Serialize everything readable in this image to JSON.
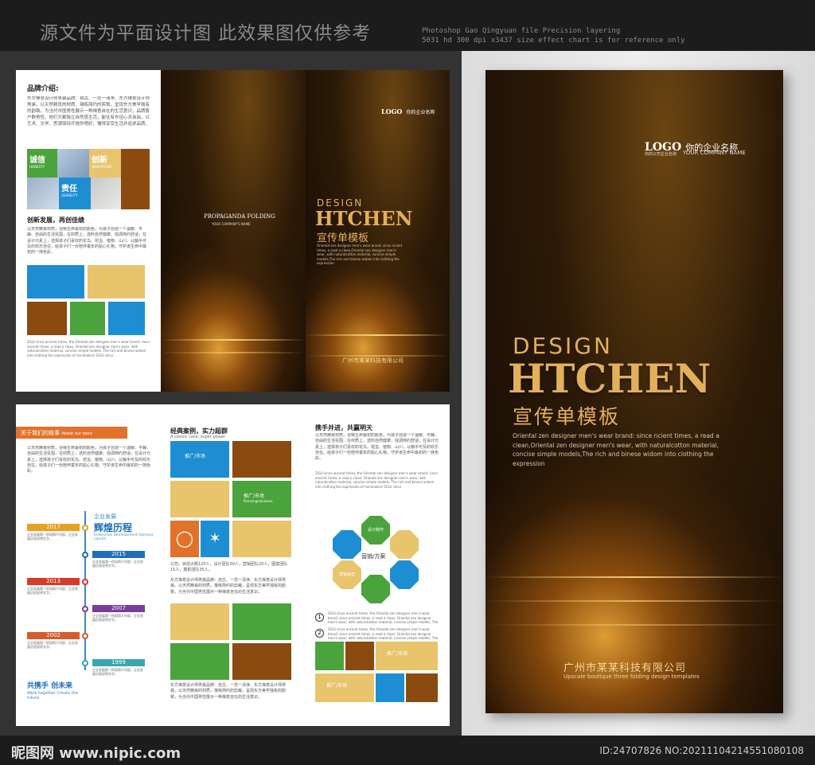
{
  "header": {
    "cn": "源文件为平面设计图  此效果图仅供参考",
    "en_line1": "Photoshop Gao Qingyuan file Precision layering",
    "en_line2": "5031 hd 300 dpi x3437 size effect chart is for reference only"
  },
  "outer": {
    "brand_title": "品牌介绍:",
    "brand_text": "东方禅意设计师男装品牌：自古、一念一清净、东方禅意设计师男装。以天然精良的材质、凝练简约的剪裁，呈现东方美学独有的韵致。为当代中国男性展示一种禅意自在的生活意识，品牌客户群男性，他们大都独立自然感生活，能往有东佳心灵自由，以艺术、文学、思潮保持开放的嗜好，懂得享受生活并追求品质。",
    "tiles": [
      "诚信",
      "创新",
      "责任"
    ],
    "tiles_en": [
      "HONESTY",
      "INNOVATION",
      "USABILITY"
    ],
    "innov_title": "创新发展，再创佳绩",
    "innov_text": "以天然精良材质，诠释生命最初的颜色，为孩子创造一个温暖、平静、自由的生活氛围，在材质上，选料自然健康、强调简约舒适；在设计元素上，选择孩子们喜欢的花鸟、昆虫、植物、山川、以触手可及的欢乐自在，给孩子们一份陪伴童年的贴心礼物，守护该生命中最初的一抹色彩。",
    "small_en": "ZiGU since ancient times, the Oriental zen designer men's wear brand: since ancient times, a read a clean, Oriental zen designer men's wear, with naturalcotton material, concise simple models, The rich and binese widom into clothing the expression of minimalism ZiGU since",
    "mid_logo": "LOGO",
    "mid_company_cn": "你的企业名称",
    "propaganda": "PROPAGANDA FOLDING",
    "your_company": "YOUR COMPANY'S NAME",
    "design": "DESIGN",
    "htchen": "HTCHEN",
    "template_cn": "宣传单模板",
    "desc_en": "Oriental zen designer men's wear brand: since ncient times, a read a clean,Oriental zen designer men's wear, with naturalcotton material, concise simple models,The rich and binese widom into clothing the expression",
    "company_cn": "广州市某某科技有限公司",
    "company_en": "Upscale boutique three folding design templates"
  },
  "inner": {
    "story_label": "关于我们的故事",
    "story_en": "About our story",
    "story_text": "以天然精良材质，诠释生命最初的颜色，为孩子创造一个温暖、平静、自由的生活氛围，在材质上，选料自然健康，强调简约舒适；在设计元素上，选择孩子们喜欢的花鸟、昆虫、植物、山川，以触手可及的欢乐自在，给孩子们一份陪伴童年的贴心礼物，守护该生命中最初的一抹色彩。",
    "timeline_title_small": "企业发展",
    "timeline_title": "辉煌历程",
    "timeline_en": "Enterprise Development Glorious course",
    "years": [
      {
        "year": "2017",
        "color": "#e8a020"
      },
      {
        "year": "2015",
        "color": "#1e6fb8"
      },
      {
        "year": "2013",
        "color": "#d63a2a"
      },
      {
        "year": "2007",
        "color": "#7a3c9a"
      },
      {
        "year": "2002",
        "color": "#d65a2a"
      },
      {
        "year": "1999",
        "color": "#3aa6b0"
      }
    ],
    "year_text": "企业发展第一阶段简介内容，企业发展历程说明文字。",
    "future_title": "共携手  创未来",
    "future_en": "Work together Create the future",
    "cases_title": "经典案例，实力超群",
    "cases_en": "A classic case, super power",
    "promo": "推广/市场",
    "promo_en": "Planning/solutions",
    "cases_text": "公司，目前大概120人，设计团队30人，营销团队20人，图案团队15人，摄影团队35人。",
    "cases_text2": "东方禅意设计师男装品牌：自古、一念一清净、东方禅意设计师男装。以天然精良的材质，凝练简约的剪裁，呈现东方美学独有的韵致，为当代中国男性展示一种禅意自在的生活意识。",
    "hand_title": "携手并进，共赢明天",
    "hand_text": "以天然精良材质，诠释生命最初的颜色，为孩子创造一个温暖、平静、自由的生活氛围，在材质上，选料自然健康，强调简约舒适；在设计元素上，选择孩子们喜欢的花鸟、昆虫、植物、山川，以触手可及的欢乐自在，给孩子们一份陪伴童年的贴心礼物，守护该生命中最初的一抹色彩。",
    "oct_center": "营销/方案",
    "oct_top": "设计制作",
    "oct_left": "营销运营",
    "num1": "1",
    "num2": "2",
    "cover_text": "东方禅意设计师男装品牌：自古、一念一清净、东方禅意设计师男装，以天然精良的材质，凝练简约的剪裁，呈现东方美学独有的韵致，为当代中国男性展示一种禅意自在的生活意识。"
  },
  "cover": {
    "logo": "LOGO",
    "company_cn": "你的企业名称",
    "company_sub": "你的公司企业名称",
    "your_company": "YOUR COMPANY NAME",
    "design": "DESIGN",
    "htchen": "HTCHEN",
    "template_cn": "宣传单模板",
    "desc_en": "Oriental zen designer men's wear brand: since ncient times, a read a clean,Oriental zen designer men's wear, with naturalcotton material, concise simple models,The rich and binese widom into clothing the expression",
    "company_name": "广州市某某科技有限公司",
    "company_en": "Upscale boutique three folding design templates"
  },
  "footer": {
    "site": "昵图网 www.nipic.com",
    "id": "ID:24707826 NO:20211104214551080108"
  }
}
